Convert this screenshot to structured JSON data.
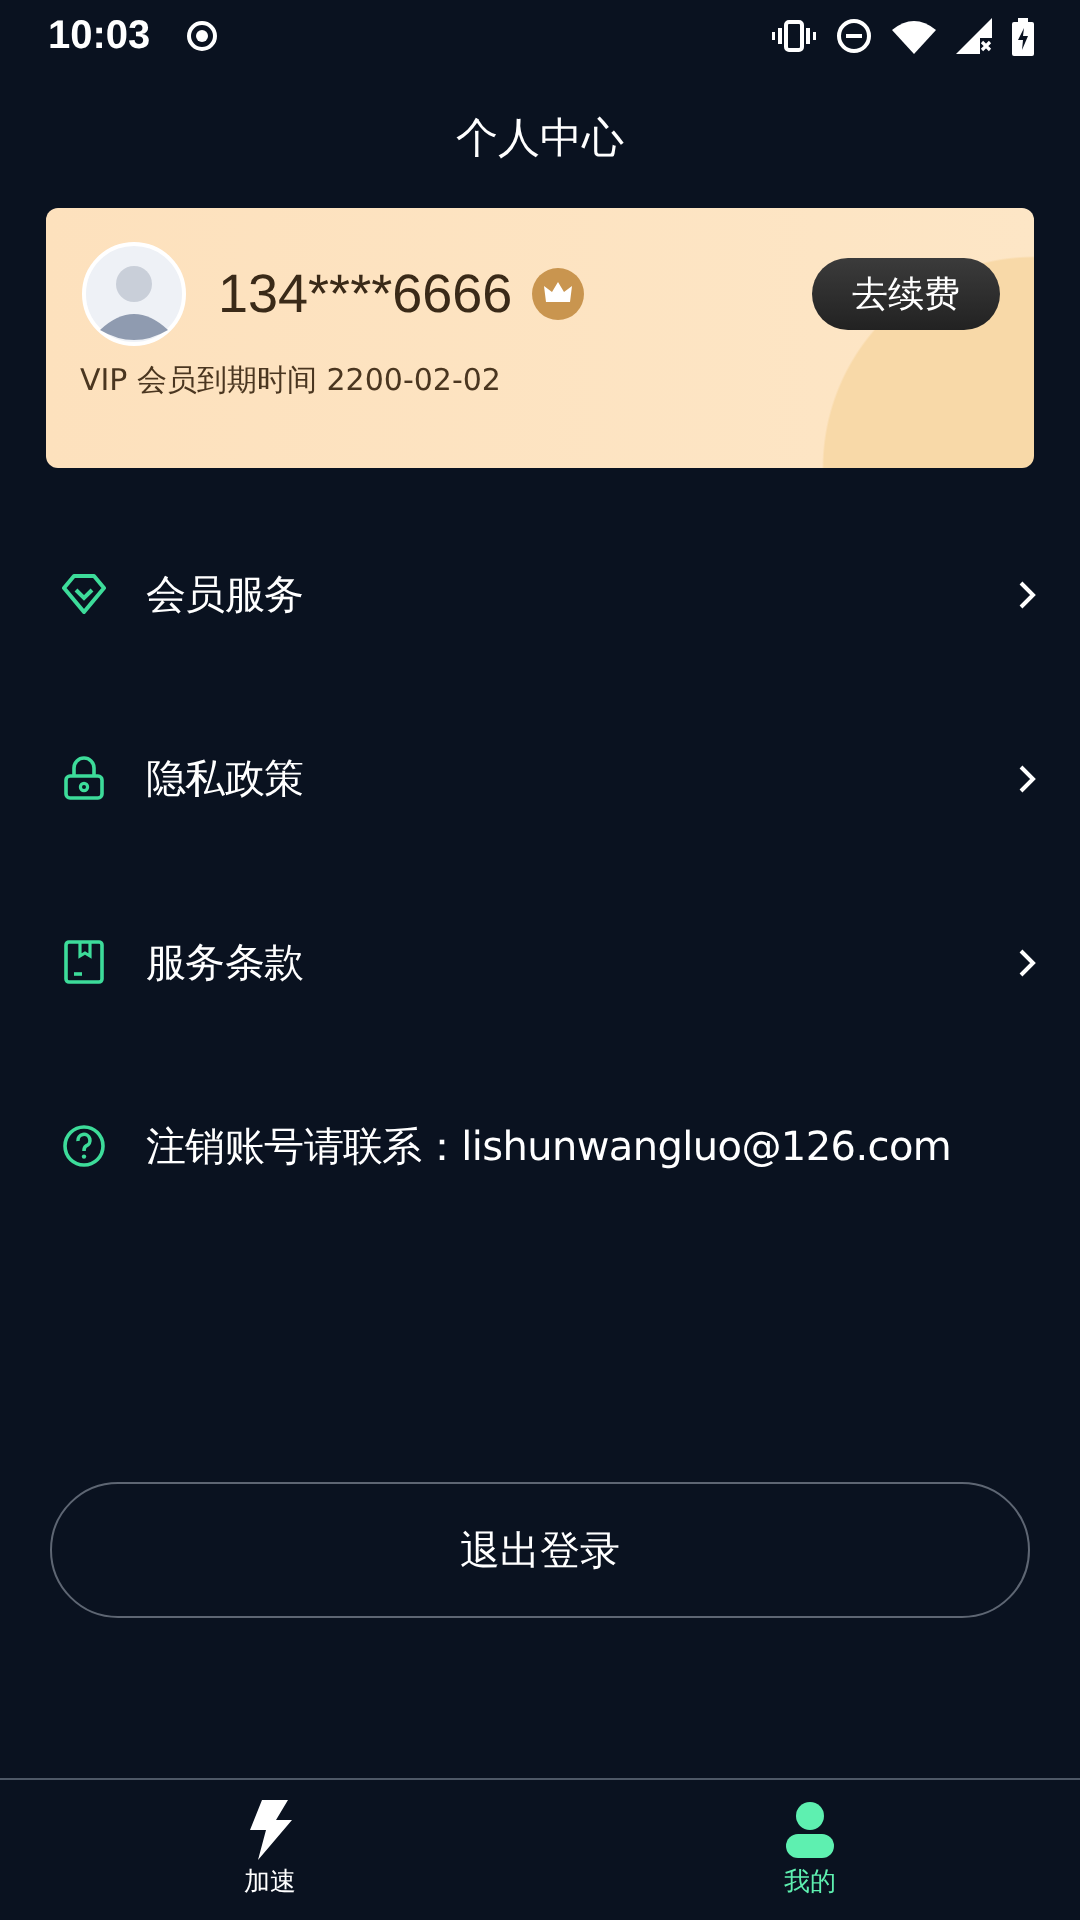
{
  "status_bar": {
    "time": "10:03"
  },
  "title": "个人中心",
  "vip_card": {
    "phone": "134****6666",
    "vip": true,
    "expiry": "VIP 会员到期时间 2200-02-02",
    "renew_button": "去续费"
  },
  "menu": [
    {
      "kind": "diamond",
      "label": "会员服务",
      "chevron": true
    },
    {
      "kind": "lock",
      "label": "隐私政策",
      "chevron": true
    },
    {
      "kind": "book",
      "label": "服务条款",
      "chevron": true
    },
    {
      "kind": "help",
      "label": "注销账号请联系：lishunwangluo@126.com",
      "chevron": false
    }
  ],
  "logout_button": "退出登录",
  "tabs": [
    {
      "kind": "bolt",
      "label": "加速",
      "selected": false
    },
    {
      "kind": "person",
      "label": "我的",
      "selected": true
    }
  ]
}
